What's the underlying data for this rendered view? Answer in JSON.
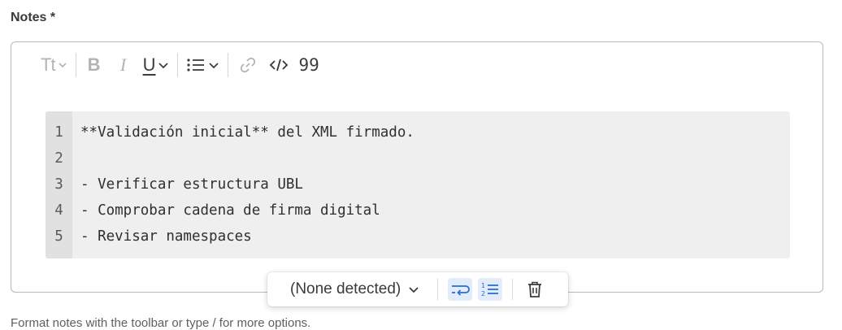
{
  "field": {
    "label": "Notes *"
  },
  "toolbar": {
    "text_style_label": "Tt",
    "bold_label": "B",
    "italic_label": "I",
    "underline_label": "U",
    "quote_label": "99"
  },
  "code_block": {
    "lines": [
      {
        "number": "1",
        "text": "**Validación inicial** del XML firmado."
      },
      {
        "number": "2",
        "text": ""
      },
      {
        "number": "3",
        "text": "- Verificar estructura UBL"
      },
      {
        "number": "4",
        "text": "- Comprobar cadena de firma digital"
      },
      {
        "number": "5",
        "text": "- Revisar namespaces"
      }
    ]
  },
  "code_toolbar": {
    "language_label": "(None detected)"
  },
  "hint": {
    "text": "Format notes with the toolbar or type / for more options."
  },
  "colors": {
    "accent": "#2a6fd6",
    "toggle_bg": "#e3ecfa",
    "code_bg": "#efefef",
    "gutter_bg": "#e1e1e1"
  }
}
